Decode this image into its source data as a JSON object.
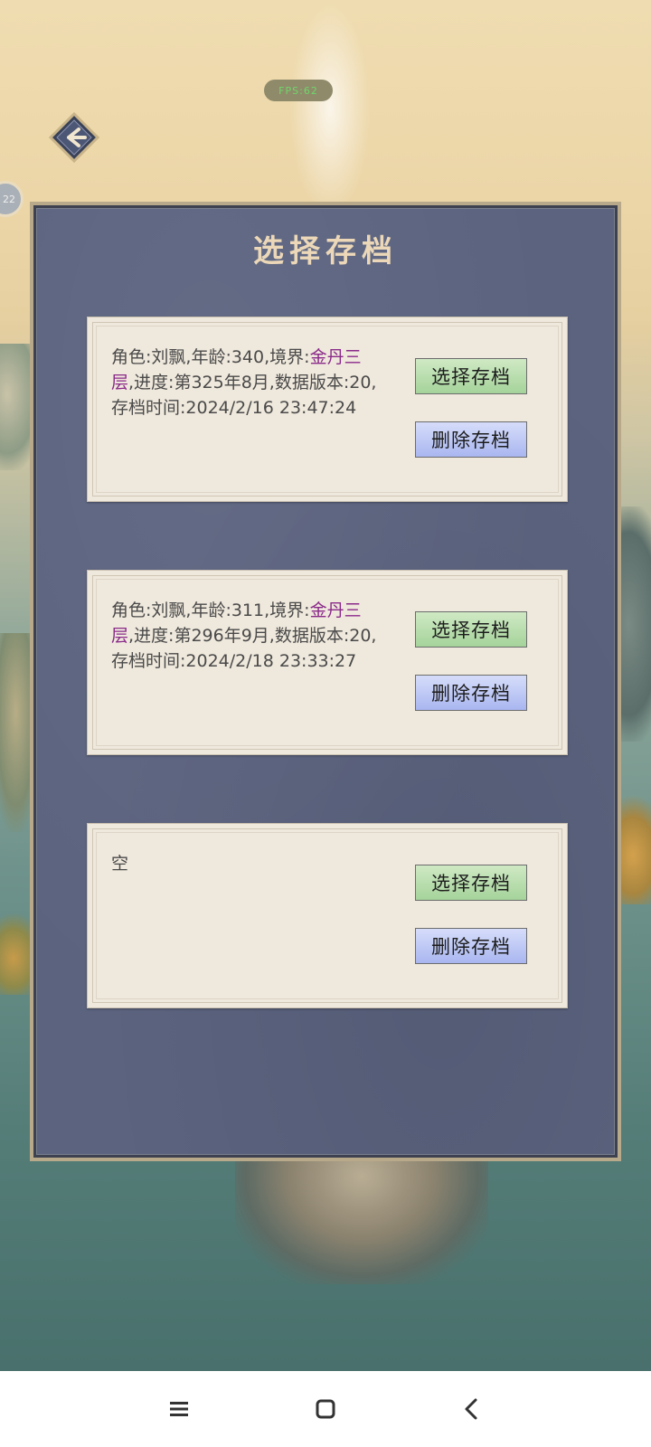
{
  "status_pill": "FPS:62",
  "side_bubble": "22",
  "panel": {
    "title": "选择存档"
  },
  "saves": [
    {
      "text_pre": "角色:刘飘,年龄:340,境界:",
      "realm": "金丹三层",
      "text_post": ",进度:第325年8月,数据版本:20,存档时间:2024/2/16 23:47:24",
      "select_label": "选择存档",
      "delete_label": "删除存档"
    },
    {
      "text_pre": "角色:刘飘,年龄:311,境界:",
      "realm": "金丹三层",
      "text_post": ",进度:第296年9月,数据版本:20,存档时间:2024/2/18 23:33:27",
      "select_label": "选择存档",
      "delete_label": "删除存档"
    },
    {
      "text_pre": "空",
      "realm": "",
      "text_post": "",
      "select_label": "选择存档",
      "delete_label": "删除存档"
    }
  ],
  "icons": {
    "back": "arrow-left-icon",
    "nav_menu": "menu-icon",
    "nav_home": "square-icon",
    "nav_back": "chevron-left-icon"
  },
  "colors": {
    "panel_bg": "#5b637f",
    "card_bg": "#efe8dc",
    "realm_text": "#8a2a8a",
    "select_button": "#b7dea9",
    "delete_button": "#b6c2f3"
  }
}
